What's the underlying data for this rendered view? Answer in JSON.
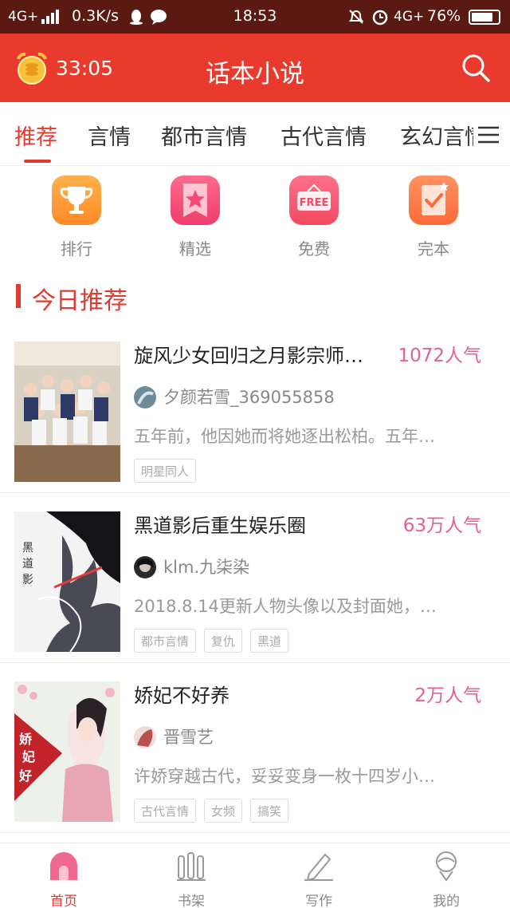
{
  "status_bar": {
    "network": "4G+",
    "speed": "0.3K/s",
    "time": "18:53",
    "network_right": "4G+",
    "battery": "76%"
  },
  "header": {
    "timer": "33:05",
    "title": "话本小说",
    "timer_icon": "alarm-clock-coin-icon",
    "search_icon": "search-icon"
  },
  "tabs": [
    "推荐",
    "言情",
    "都市言情",
    "古代言情",
    "玄幻言情"
  ],
  "quick_entries": [
    {
      "label": "排行",
      "icon": "trophy-icon",
      "color": "#ff9a3c"
    },
    {
      "label": "精选",
      "icon": "star-icon",
      "color": "#f4517a"
    },
    {
      "label": "免费",
      "icon": "free-sign-icon",
      "color": "#f45a6f"
    },
    {
      "label": "完本",
      "icon": "completed-book-icon",
      "color": "#ff7a4a"
    }
  ],
  "section": {
    "title": "今日推荐"
  },
  "books": [
    {
      "title": "旋风少女回归之月影宗师…",
      "heat": "1072人气",
      "author": "夕颜若雪_369055858",
      "desc": "五年前，他因她而将她逐出松柏。五年…",
      "tags": [
        "明星同人"
      ]
    },
    {
      "title": "黑道影后重生娱乐圈",
      "heat": "63万人气",
      "author": "klm.九柒染",
      "desc": "2018.8.14更新人物头像以及封面她，…",
      "tags": [
        "都市言情",
        "复仇",
        "黑道"
      ]
    },
    {
      "title": "娇妃不好养",
      "heat": "2万人气",
      "author": "晋雪艺",
      "desc": "许娇穿越古代，妥妥变身一枚十四岁小…",
      "tags": [
        "古代言情",
        "女频",
        "搞笑"
      ]
    }
  ],
  "bottom_nav": [
    {
      "label": "首页",
      "icon": "home-icon"
    },
    {
      "label": "书架",
      "icon": "bookshelf-icon"
    },
    {
      "label": "写作",
      "icon": "pen-icon"
    },
    {
      "label": "我的",
      "icon": "profile-icon"
    }
  ],
  "colors": {
    "accent": "#e33a2f",
    "header": "#e93a2e",
    "heat": "#e0609a",
    "statusbar": "#5a1a12"
  }
}
